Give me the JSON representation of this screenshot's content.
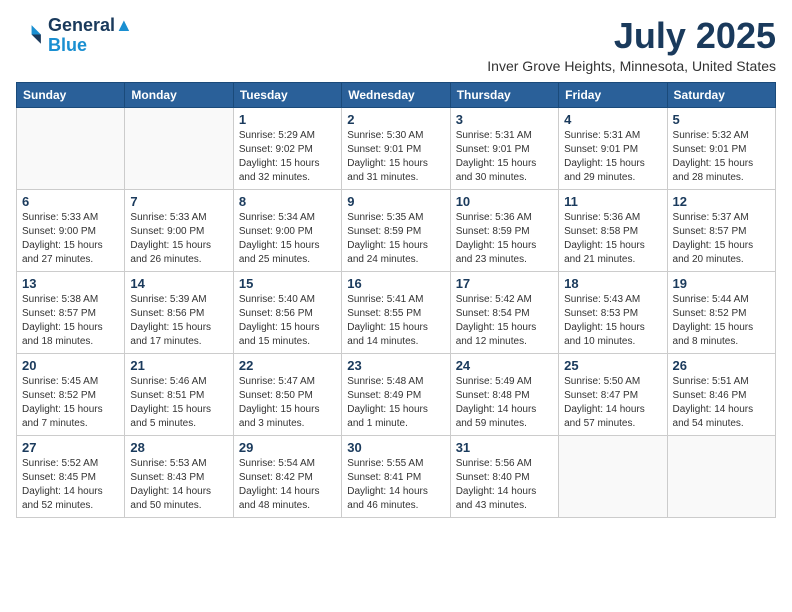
{
  "header": {
    "logo_line1": "General",
    "logo_line2": "Blue",
    "month": "July 2025",
    "location": "Inver Grove Heights, Minnesota, United States"
  },
  "weekdays": [
    "Sunday",
    "Monday",
    "Tuesday",
    "Wednesday",
    "Thursday",
    "Friday",
    "Saturday"
  ],
  "weeks": [
    [
      {
        "day": "",
        "info": ""
      },
      {
        "day": "",
        "info": ""
      },
      {
        "day": "1",
        "info": "Sunrise: 5:29 AM\nSunset: 9:02 PM\nDaylight: 15 hours\nand 32 minutes."
      },
      {
        "day": "2",
        "info": "Sunrise: 5:30 AM\nSunset: 9:01 PM\nDaylight: 15 hours\nand 31 minutes."
      },
      {
        "day": "3",
        "info": "Sunrise: 5:31 AM\nSunset: 9:01 PM\nDaylight: 15 hours\nand 30 minutes."
      },
      {
        "day": "4",
        "info": "Sunrise: 5:31 AM\nSunset: 9:01 PM\nDaylight: 15 hours\nand 29 minutes."
      },
      {
        "day": "5",
        "info": "Sunrise: 5:32 AM\nSunset: 9:01 PM\nDaylight: 15 hours\nand 28 minutes."
      }
    ],
    [
      {
        "day": "6",
        "info": "Sunrise: 5:33 AM\nSunset: 9:00 PM\nDaylight: 15 hours\nand 27 minutes."
      },
      {
        "day": "7",
        "info": "Sunrise: 5:33 AM\nSunset: 9:00 PM\nDaylight: 15 hours\nand 26 minutes."
      },
      {
        "day": "8",
        "info": "Sunrise: 5:34 AM\nSunset: 9:00 PM\nDaylight: 15 hours\nand 25 minutes."
      },
      {
        "day": "9",
        "info": "Sunrise: 5:35 AM\nSunset: 8:59 PM\nDaylight: 15 hours\nand 24 minutes."
      },
      {
        "day": "10",
        "info": "Sunrise: 5:36 AM\nSunset: 8:59 PM\nDaylight: 15 hours\nand 23 minutes."
      },
      {
        "day": "11",
        "info": "Sunrise: 5:36 AM\nSunset: 8:58 PM\nDaylight: 15 hours\nand 21 minutes."
      },
      {
        "day": "12",
        "info": "Sunrise: 5:37 AM\nSunset: 8:57 PM\nDaylight: 15 hours\nand 20 minutes."
      }
    ],
    [
      {
        "day": "13",
        "info": "Sunrise: 5:38 AM\nSunset: 8:57 PM\nDaylight: 15 hours\nand 18 minutes."
      },
      {
        "day": "14",
        "info": "Sunrise: 5:39 AM\nSunset: 8:56 PM\nDaylight: 15 hours\nand 17 minutes."
      },
      {
        "day": "15",
        "info": "Sunrise: 5:40 AM\nSunset: 8:56 PM\nDaylight: 15 hours\nand 15 minutes."
      },
      {
        "day": "16",
        "info": "Sunrise: 5:41 AM\nSunset: 8:55 PM\nDaylight: 15 hours\nand 14 minutes."
      },
      {
        "day": "17",
        "info": "Sunrise: 5:42 AM\nSunset: 8:54 PM\nDaylight: 15 hours\nand 12 minutes."
      },
      {
        "day": "18",
        "info": "Sunrise: 5:43 AM\nSunset: 8:53 PM\nDaylight: 15 hours\nand 10 minutes."
      },
      {
        "day": "19",
        "info": "Sunrise: 5:44 AM\nSunset: 8:52 PM\nDaylight: 15 hours\nand 8 minutes."
      }
    ],
    [
      {
        "day": "20",
        "info": "Sunrise: 5:45 AM\nSunset: 8:52 PM\nDaylight: 15 hours\nand 7 minutes."
      },
      {
        "day": "21",
        "info": "Sunrise: 5:46 AM\nSunset: 8:51 PM\nDaylight: 15 hours\nand 5 minutes."
      },
      {
        "day": "22",
        "info": "Sunrise: 5:47 AM\nSunset: 8:50 PM\nDaylight: 15 hours\nand 3 minutes."
      },
      {
        "day": "23",
        "info": "Sunrise: 5:48 AM\nSunset: 8:49 PM\nDaylight: 15 hours\nand 1 minute."
      },
      {
        "day": "24",
        "info": "Sunrise: 5:49 AM\nSunset: 8:48 PM\nDaylight: 14 hours\nand 59 minutes."
      },
      {
        "day": "25",
        "info": "Sunrise: 5:50 AM\nSunset: 8:47 PM\nDaylight: 14 hours\nand 57 minutes."
      },
      {
        "day": "26",
        "info": "Sunrise: 5:51 AM\nSunset: 8:46 PM\nDaylight: 14 hours\nand 54 minutes."
      }
    ],
    [
      {
        "day": "27",
        "info": "Sunrise: 5:52 AM\nSunset: 8:45 PM\nDaylight: 14 hours\nand 52 minutes."
      },
      {
        "day": "28",
        "info": "Sunrise: 5:53 AM\nSunset: 8:43 PM\nDaylight: 14 hours\nand 50 minutes."
      },
      {
        "day": "29",
        "info": "Sunrise: 5:54 AM\nSunset: 8:42 PM\nDaylight: 14 hours\nand 48 minutes."
      },
      {
        "day": "30",
        "info": "Sunrise: 5:55 AM\nSunset: 8:41 PM\nDaylight: 14 hours\nand 46 minutes."
      },
      {
        "day": "31",
        "info": "Sunrise: 5:56 AM\nSunset: 8:40 PM\nDaylight: 14 hours\nand 43 minutes."
      },
      {
        "day": "",
        "info": ""
      },
      {
        "day": "",
        "info": ""
      }
    ]
  ]
}
